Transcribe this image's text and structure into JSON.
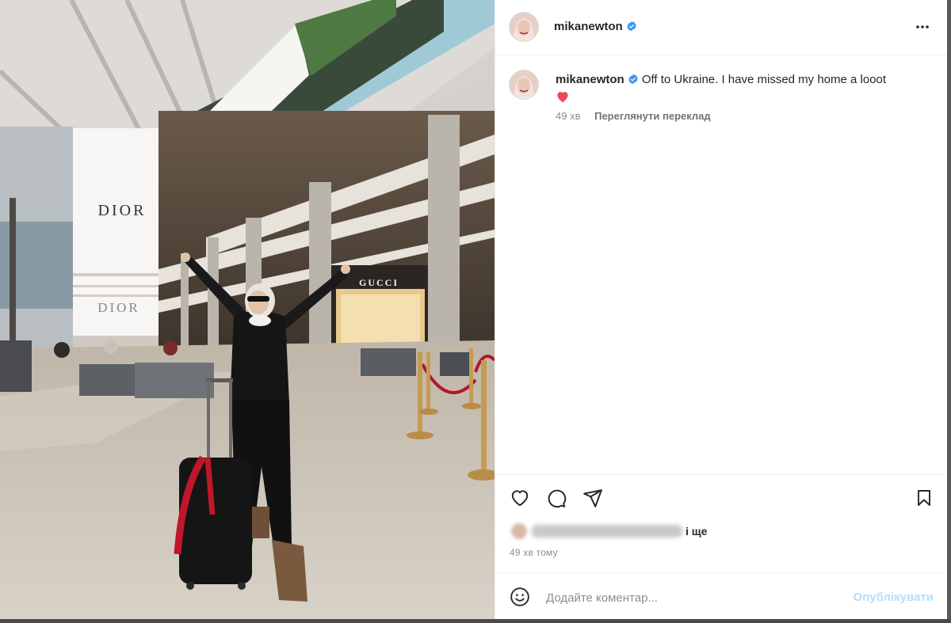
{
  "post": {
    "username": "mikanewton",
    "caption": "Off to Ukraine. I have missed my home a looot",
    "caption_emoji": "heart-emoji",
    "caption_age": "49 хв",
    "translate_label": "Переглянути переклад",
    "likes_suffix": "і ще",
    "post_age": "49 хв тому"
  },
  "photo": {
    "store_sign_1": "DIOR",
    "store_sign_2": "DIOR",
    "store_sign_3": "GUCCI"
  },
  "comment": {
    "placeholder": "Додайте коментар...",
    "post_label": "Опублікувати"
  },
  "icons": {
    "verified": "verified-badge-icon",
    "more": "more-options-icon",
    "like": "heart-icon",
    "comment": "comment-icon",
    "share": "paper-plane-icon",
    "save": "bookmark-icon",
    "emoji": "smiley-icon"
  },
  "colors": {
    "verified_blue": "#3897f0",
    "heart_red": "#ed4956",
    "post_button_disabled": "#b2dffc"
  }
}
